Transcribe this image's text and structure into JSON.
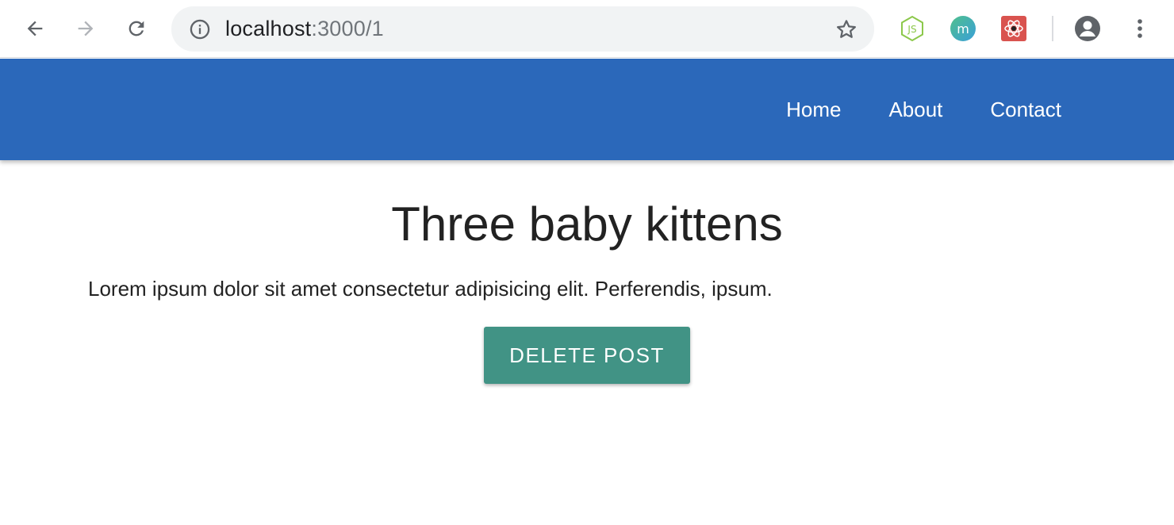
{
  "browser": {
    "url_host": "localhost",
    "url_path": ":3000/1"
  },
  "nav": {
    "links": [
      "Home",
      "About",
      "Contact"
    ]
  },
  "post": {
    "title": "Three baby kittens",
    "body": "Lorem ipsum dolor sit amet consectetur adipisicing elit. Perferendis, ipsum.",
    "delete_label": "DELETE POST"
  },
  "colors": {
    "nav_bg": "#2b68ba",
    "button_bg": "#419385"
  },
  "icons": {
    "back": "back-arrow-icon",
    "forward": "forward-arrow-icon",
    "reload": "reload-icon",
    "info": "info-icon",
    "star": "star-icon",
    "ext1": "nodejs-extension-icon",
    "ext2": "m-extension-icon",
    "ext3": "react-devtools-icon",
    "account": "account-icon",
    "menu": "kebab-menu-icon"
  }
}
